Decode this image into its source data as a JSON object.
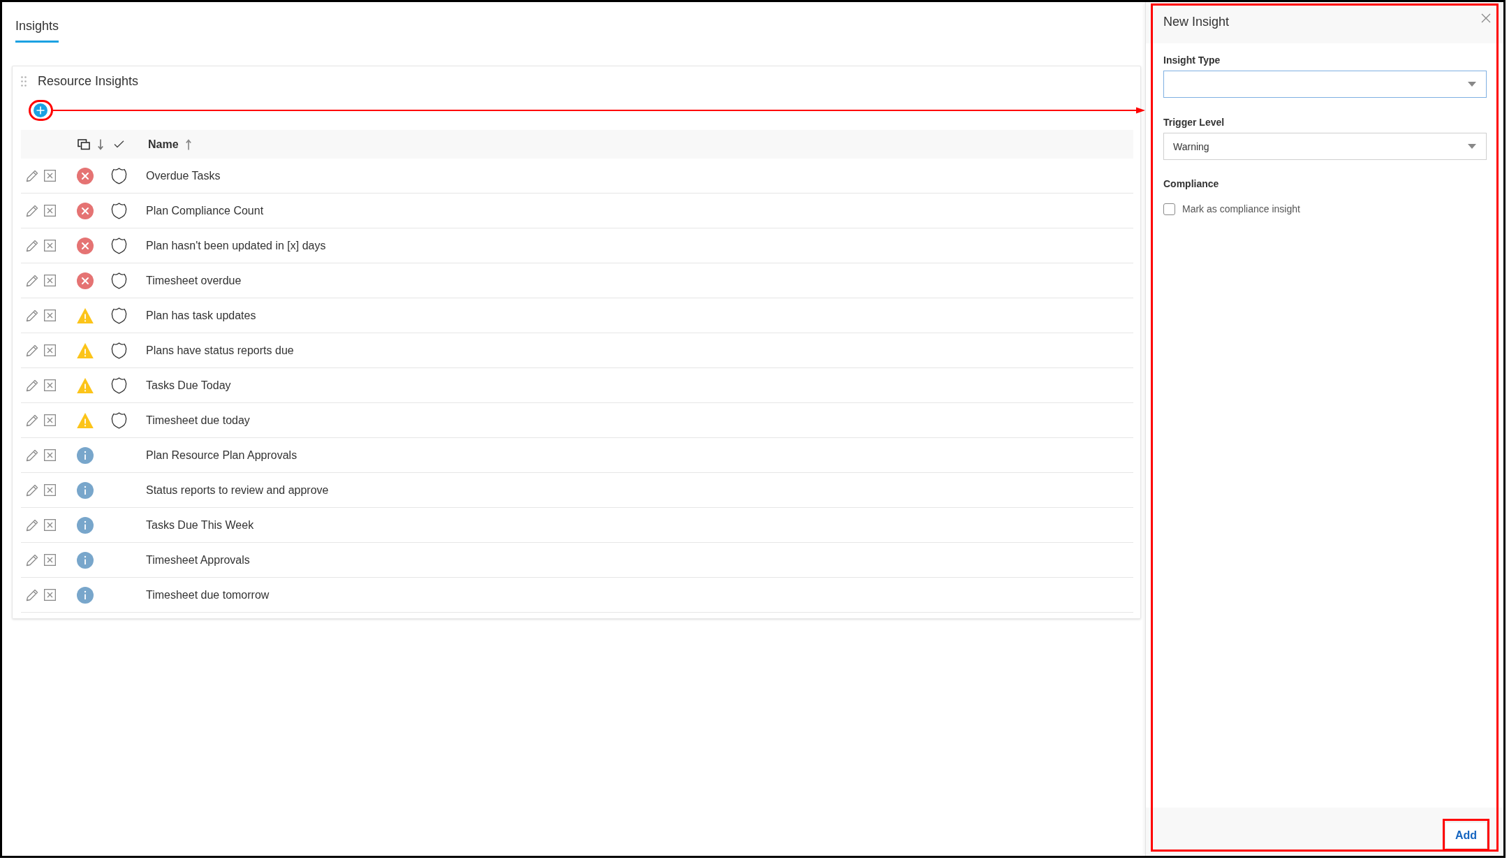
{
  "tabs": [
    {
      "label": "Insights",
      "selected": true
    }
  ],
  "card": {
    "title": "Resource Insights",
    "table": {
      "columns": [
        {
          "kind": "level",
          "sorted": true,
          "descending": true
        },
        {
          "kind": "compliance"
        },
        {
          "kind": "name",
          "label": "Name",
          "sorted": true,
          "descending": false
        }
      ],
      "rows": [
        {
          "kind": "error",
          "compliance": true,
          "name": "Overdue Tasks"
        },
        {
          "kind": "error",
          "compliance": true,
          "name": "Plan Compliance Count"
        },
        {
          "kind": "error",
          "compliance": true,
          "name": "Plan hasn't been updated in [x] days"
        },
        {
          "kind": "error",
          "compliance": true,
          "name": "Timesheet overdue"
        },
        {
          "kind": "warning",
          "compliance": true,
          "name": "Plan has task updates"
        },
        {
          "kind": "warning",
          "compliance": true,
          "name": "Plans have status reports due"
        },
        {
          "kind": "warning",
          "compliance": true,
          "name": "Tasks Due Today"
        },
        {
          "kind": "warning",
          "compliance": true,
          "name": "Timesheet due today"
        },
        {
          "kind": "info",
          "compliance": false,
          "name": "Plan Resource Plan Approvals"
        },
        {
          "kind": "info",
          "compliance": false,
          "name": "Status reports to review and approve"
        },
        {
          "kind": "info",
          "compliance": false,
          "name": "Tasks Due This Week"
        },
        {
          "kind": "info",
          "compliance": false,
          "name": "Timesheet Approvals"
        },
        {
          "kind": "info",
          "compliance": false,
          "name": "Timesheet due tomorrow"
        }
      ]
    }
  },
  "panel": {
    "title": "New Insight",
    "fields": [
      {
        "kind": "select",
        "label": "Insight Type",
        "focused": true
      },
      {
        "kind": "select",
        "label": "Trigger Level",
        "value": "Warning",
        "focused": false
      },
      {
        "kind": "checkbox",
        "label": "Compliance",
        "option": "Mark as compliance insight",
        "checked": false
      }
    ],
    "buttons": [
      {
        "label": "Add"
      }
    ]
  }
}
